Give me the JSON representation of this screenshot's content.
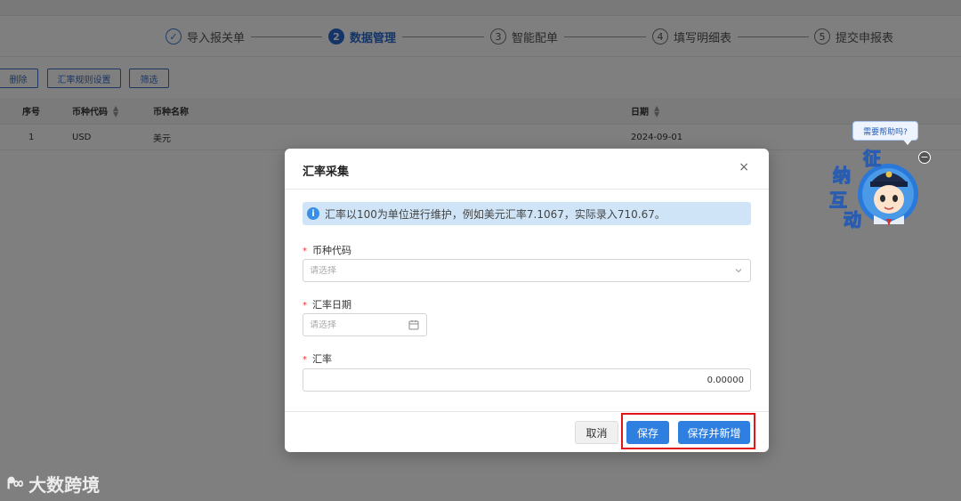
{
  "steps": [
    {
      "num": "✓",
      "label": "导入报关单",
      "state": "done"
    },
    {
      "num": "2",
      "label": "数据管理",
      "state": "active"
    },
    {
      "num": "3",
      "label": "智能配单",
      "state": "todo"
    },
    {
      "num": "4",
      "label": "填写明细表",
      "state": "todo"
    },
    {
      "num": "5",
      "label": "提交申报表",
      "state": "todo"
    }
  ],
  "toolbar": {
    "delete_label": "删除",
    "rate_rule_label": "汇率规则设置",
    "filter_label": "筛选"
  },
  "table": {
    "columns": [
      "序号",
      "币种代码",
      "币种名称",
      "日期"
    ],
    "rows": [
      {
        "index": "1",
        "code": "USD",
        "name": "美元",
        "date": "2024-09-01"
      }
    ]
  },
  "dialog": {
    "title": "汇率采集",
    "close_glyph": "×",
    "info": "汇率以100为单位进行维护，例如美元汇率7.1067，实际录入710.67。",
    "fields": {
      "currency": {
        "label": "币种代码",
        "placeholder": "请选择",
        "value": ""
      },
      "date": {
        "label": "汇率日期",
        "placeholder": "请选择",
        "value": ""
      },
      "rate": {
        "label": "汇率",
        "value": "0.00000"
      }
    },
    "required_mark": "*",
    "buttons": {
      "cancel": "取消",
      "save": "保存",
      "save_and_new": "保存并新增"
    }
  },
  "helper": {
    "bubble": "需要帮助吗?",
    "mascot_text": [
      "征",
      "纳",
      "互",
      "动"
    ],
    "minimize_glyph": "−"
  },
  "watermark": {
    "logo": "ᖰ∞",
    "text": "大数跨境"
  },
  "colors": {
    "primary": "#2f7fe0",
    "info_bg": "#cfe5f7",
    "highlight": "#e0161b",
    "required": "#e33333"
  }
}
